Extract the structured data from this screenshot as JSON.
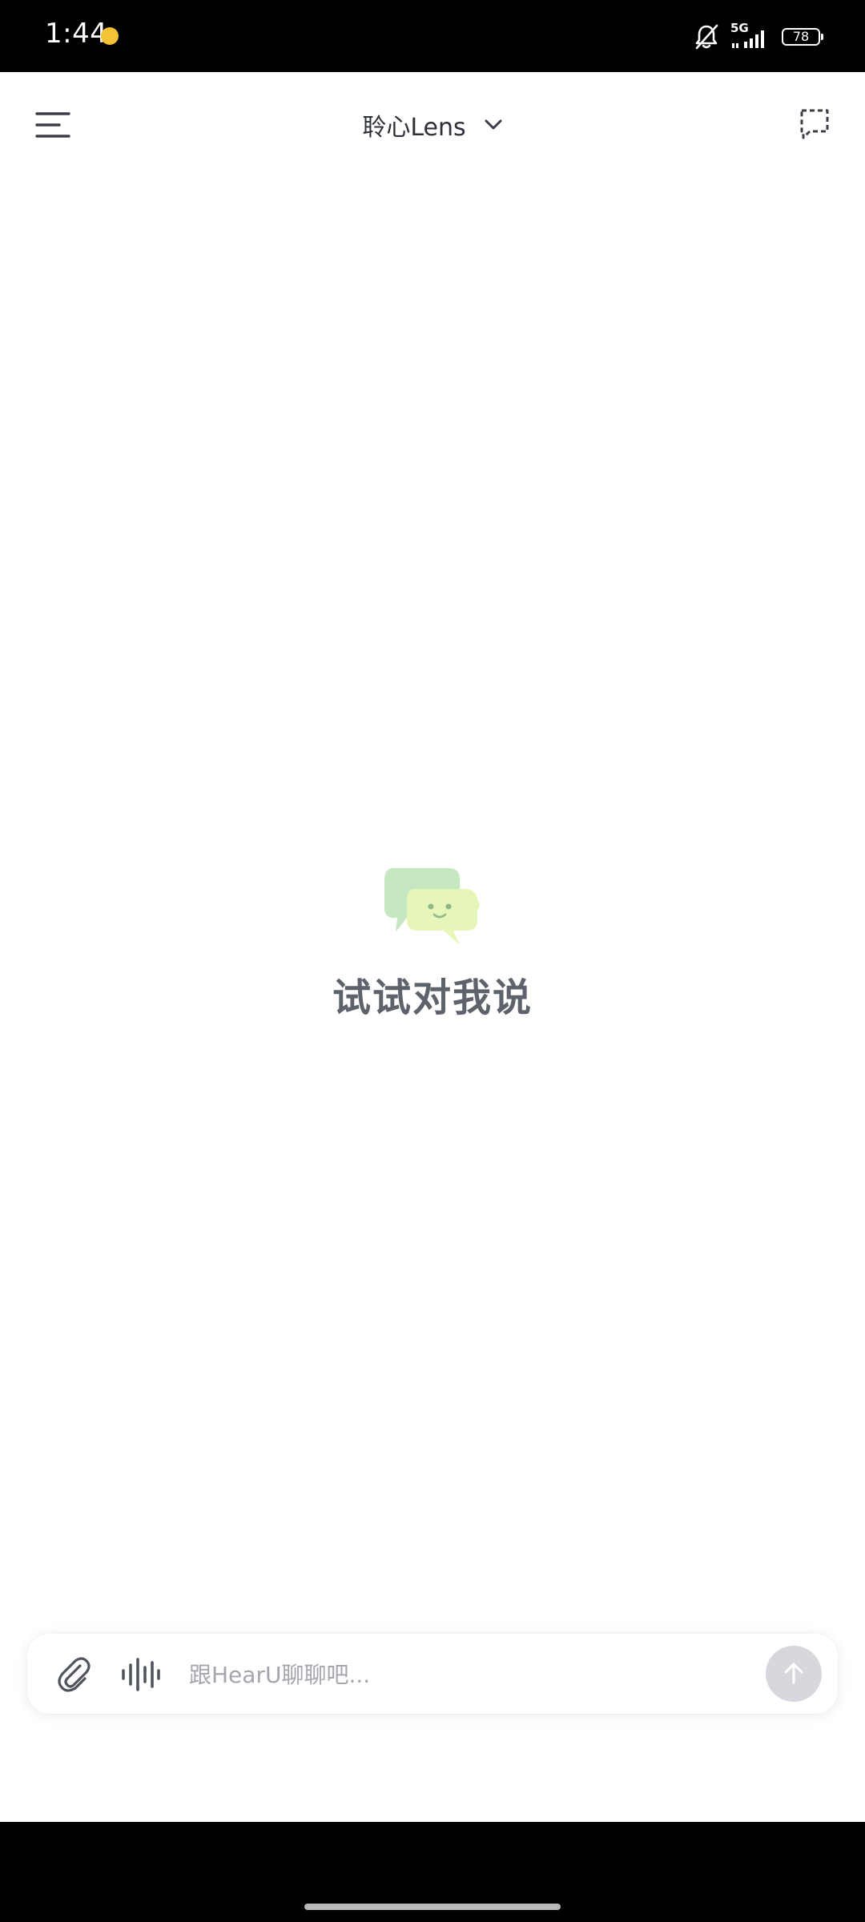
{
  "status_bar": {
    "time": "1:44",
    "network": "5G",
    "battery": "78",
    "icons": [
      "notification-emoji-icon",
      "mute-bell-icon",
      "signal-5g-icon",
      "battery-icon"
    ]
  },
  "header": {
    "title": "聆心Lens",
    "icons": [
      "menu-icon",
      "chevron-down-icon",
      "new-chat-icon"
    ]
  },
  "empty_state": {
    "message": "试试对我说",
    "icon": "chat-mascot-icon"
  },
  "composer": {
    "placeholder": "跟HearU聊聊吧...",
    "value": "",
    "icons": [
      "paperclip-icon",
      "voice-wave-icon",
      "send-arrow-icon"
    ]
  },
  "colors": {
    "title_text": "#2e3038",
    "empty_text": "#5d626b",
    "placeholder": "#a3a6ad",
    "send_button": "#d6d8de",
    "mascot_back": "#c6e8c0",
    "mascot_front": "#e6f6b8"
  }
}
